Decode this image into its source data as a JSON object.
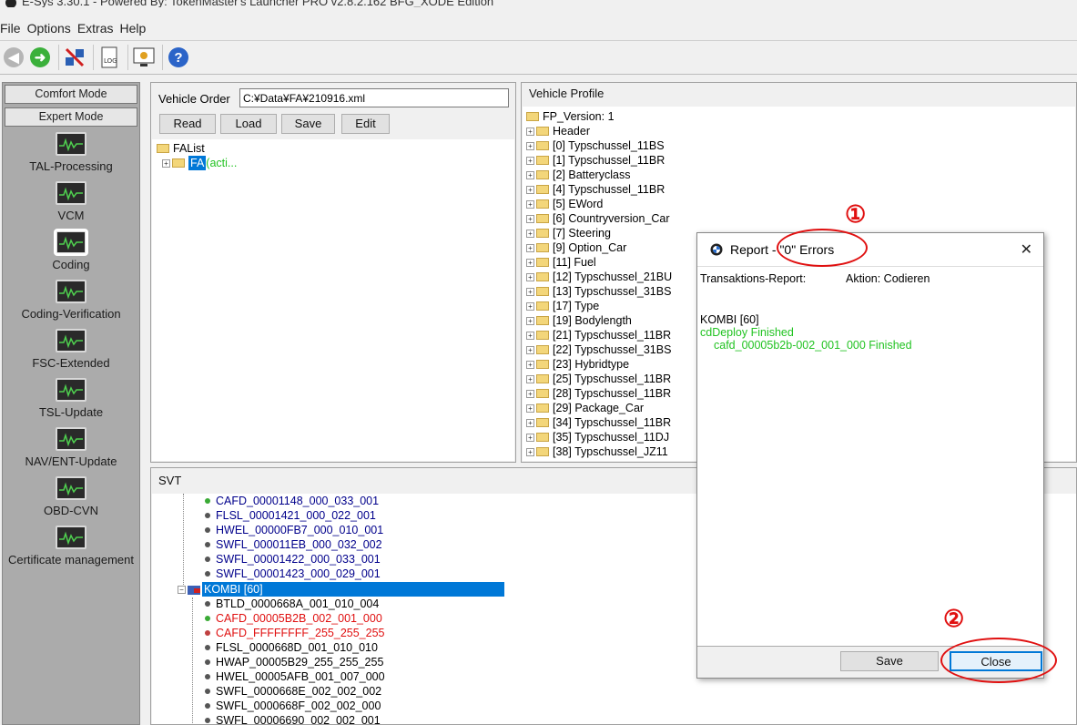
{
  "window_title": "E-Sys 3.30.1 - Powered By: TokenMaster's Launcher PRO v2.8.2.162 BFG_XODE Edition",
  "menu": [
    "File",
    "Options",
    "Extras",
    "Help"
  ],
  "left_panel": {
    "comfort_mode": "Comfort Mode",
    "expert_mode": "Expert Mode",
    "items": [
      "TAL-Processing",
      "VCM",
      "Coding",
      "Coding-Verification",
      "FSC-Extended",
      "TSL-Update",
      "NAV/ENT-Update",
      "OBD-CVN",
      "Certificate management"
    ],
    "selected": "Coding"
  },
  "vehicle_order": {
    "label": "Vehicle Order",
    "path": "C:¥Data¥FA¥210916.xml",
    "buttons": {
      "read": "Read",
      "load": "Load",
      "save": "Save",
      "edit": "Edit"
    },
    "tree_root": "FAList",
    "tree_child": "FA",
    "tree_child_suffix": "(acti..."
  },
  "vehicle_profile": {
    "title": "Vehicle Profile",
    "root": "FP_Version: 1",
    "items": [
      "Header",
      "[0] Typschussel_11BS",
      "[1] Typschussel_11BR",
      "[2] Batteryclass",
      "[4] Typschussel_11BR",
      "[5] EWord",
      "[6] Countryversion_Car",
      "[7] Steering",
      "[9] Option_Car",
      "[11] Fuel",
      "[12] Typschussel_21BU",
      "[13] Typschussel_31BS",
      "[17] Type",
      "[19] Bodylength",
      "[21] Typschussel_11BR",
      "[22] Typschussel_31BS",
      "[23] Hybridtype",
      "[25] Typschussel_11BR",
      "[28] Typschussel_11BR",
      "[29] Package_Car",
      "[34] Typschussel_11BR",
      "[35] Typschussel_11DJ",
      "[38] Typschussel_JZ11"
    ]
  },
  "svt": {
    "title": "SVT",
    "upper_items": [
      {
        "text": "CAFD_00001148_000_033_001",
        "color": "#00008b",
        "dot": "#3aaa35"
      },
      {
        "text": "FLSL_00001421_000_022_001",
        "color": "#00008b",
        "dot": "#555555"
      },
      {
        "text": "HWEL_00000FB7_000_010_001",
        "color": "#00008b",
        "dot": "#555555"
      },
      {
        "text": "SWFL_000011EB_000_032_002",
        "color": "#00008b",
        "dot": "#555555"
      },
      {
        "text": "SWFL_00001422_000_033_001",
        "color": "#00008b",
        "dot": "#555555"
      },
      {
        "text": "SWFL_00001423_000_029_001",
        "color": "#00008b",
        "dot": "#555555"
      }
    ],
    "selected_ecu": "KOMBI [60]",
    "lower_items": [
      {
        "text": "BTLD_0000668A_001_010_004",
        "color": "#000000",
        "dot": "#555555"
      },
      {
        "text": "CAFD_00005B2B_002_001_000",
        "color": "#e01010",
        "dot": "#3aaa35"
      },
      {
        "text": "CAFD_FFFFFFFF_255_255_255",
        "color": "#e01010",
        "dot": "#c04040"
      },
      {
        "text": "FLSL_0000668D_001_010_010",
        "color": "#000000",
        "dot": "#555555"
      },
      {
        "text": "HWAP_00005B29_255_255_255",
        "color": "#000000",
        "dot": "#555555"
      },
      {
        "text": "HWEL_00005AFB_001_007_000",
        "color": "#000000",
        "dot": "#555555"
      },
      {
        "text": "SWFL_0000668E_002_002_002",
        "color": "#000000",
        "dot": "#555555"
      },
      {
        "text": "SWFL_0000668F_002_002_000",
        "color": "#000000",
        "dot": "#555555"
      },
      {
        "text": "SWFL_00006690_002_002_001",
        "color": "#000000",
        "dot": "#555555"
      }
    ]
  },
  "dialog": {
    "title": "Report - \"0\" Errors",
    "close_x": "✕",
    "report_label": "Transaktions-Report:",
    "action_label": "Aktion: Codieren",
    "line_ecu": "KOMBI [60]",
    "line_deploy": "cdDeploy Finished",
    "line_cafd": "cafd_00005b2b-002_001_000 Finished",
    "save_button": "Save",
    "close_button": "Close"
  },
  "annotations": {
    "one": "①",
    "two": "②"
  },
  "colors": {
    "green_text": "#22c322",
    "selection_blue": "#0078d7",
    "annotation_red": "#e01010"
  }
}
